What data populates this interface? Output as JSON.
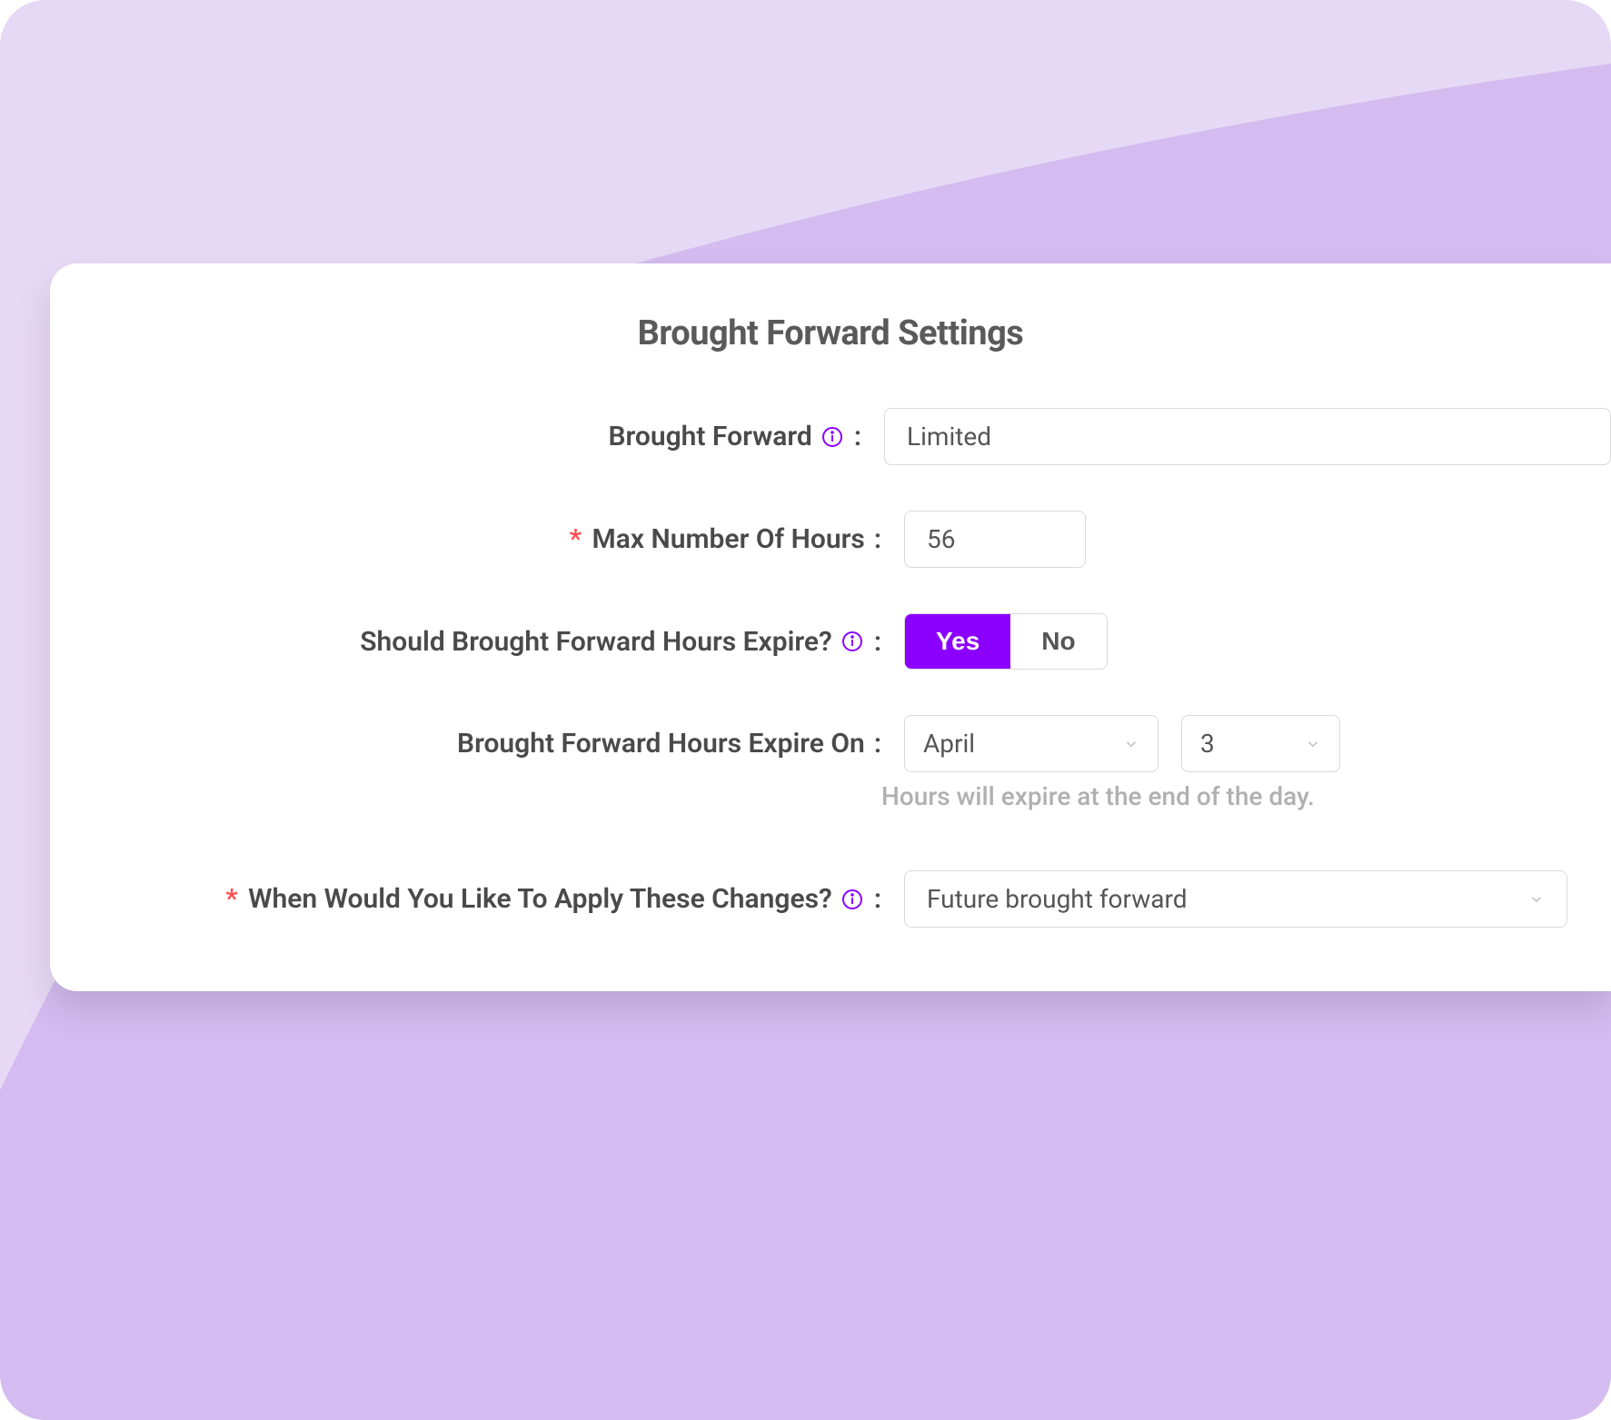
{
  "card": {
    "title": "Brought Forward Settings"
  },
  "fields": {
    "broughtForward": {
      "label": "Brought Forward",
      "value": "Limited"
    },
    "maxHours": {
      "label": "Max Number Of Hours",
      "value": "56"
    },
    "shouldExpire": {
      "label": "Should Brought Forward Hours Expire?",
      "yesLabel": "Yes",
      "noLabel": "No"
    },
    "expireOn": {
      "label": "Brought Forward Hours Expire On",
      "month": "April",
      "day": "3",
      "hint": "Hours will expire at the end of the day."
    },
    "applyChanges": {
      "label": "When Would You Like To Apply These Changes?",
      "value": "Future brought forward"
    }
  }
}
